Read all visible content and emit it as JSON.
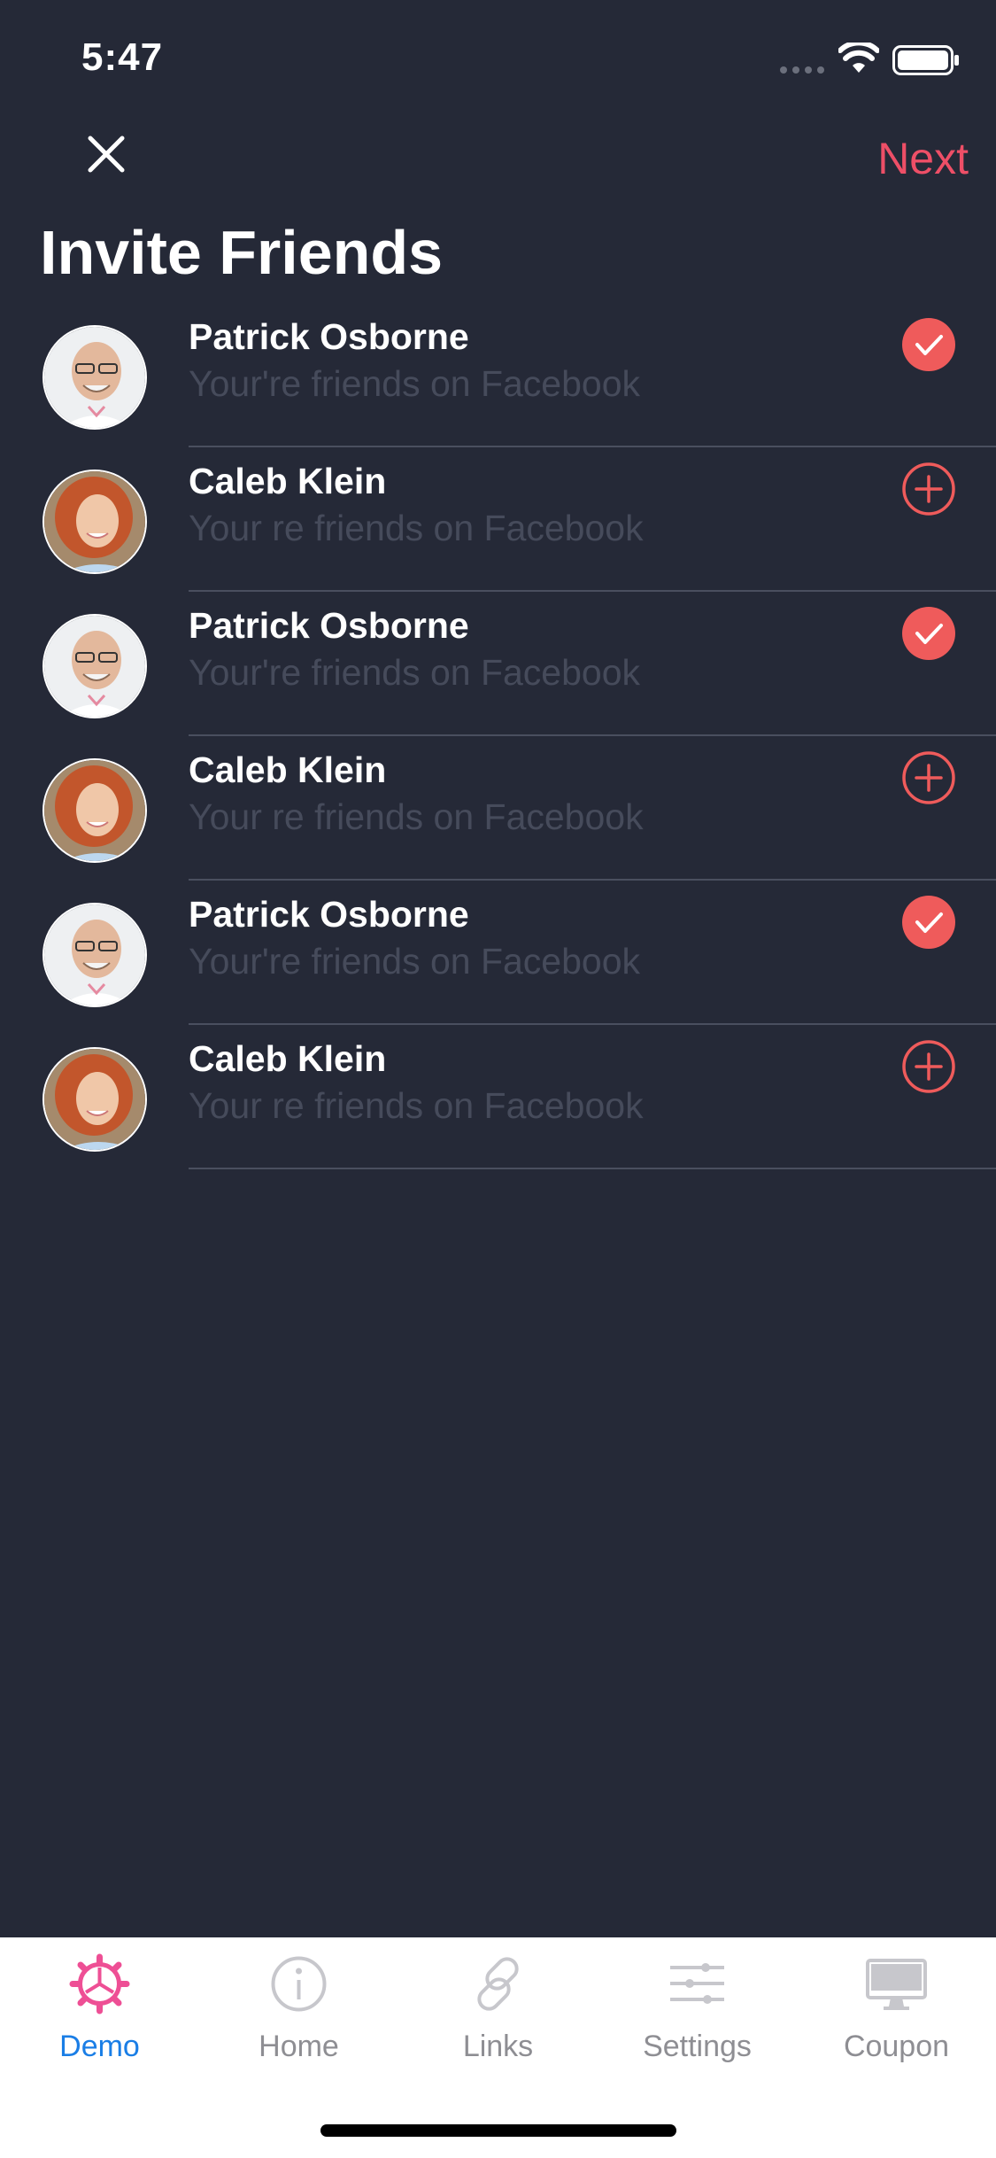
{
  "status_bar": {
    "time": "5:47"
  },
  "header": {
    "title": "Invite Friends",
    "next_label": "Next"
  },
  "colors": {
    "background": "#252937",
    "accent": "#ee4f67",
    "tab_active": "#1a7ee6",
    "tab_inactive": "#8e8e93",
    "subtext": "#464b5b"
  },
  "friends": [
    {
      "name": "Patrick Osborne",
      "subtitle": "Your're friends on Facebook",
      "avatar": "man",
      "selected": true
    },
    {
      "name": "Caleb Klein",
      "subtitle": "Your re friends on Facebook",
      "avatar": "woman",
      "selected": false
    },
    {
      "name": "Patrick Osborne",
      "subtitle": "Your're friends on Facebook",
      "avatar": "man",
      "selected": true
    },
    {
      "name": "Caleb Klein",
      "subtitle": "Your re friends on Facebook",
      "avatar": "woman",
      "selected": false
    },
    {
      "name": "Patrick Osborne",
      "subtitle": "Your're friends on Facebook",
      "avatar": "man",
      "selected": true
    },
    {
      "name": "Caleb Klein",
      "subtitle": "Your re friends on Facebook",
      "avatar": "woman",
      "selected": false
    }
  ],
  "tabs": [
    {
      "label": "Demo",
      "icon": "gear-icon",
      "active": true
    },
    {
      "label": "Home",
      "icon": "info-icon",
      "active": false
    },
    {
      "label": "Links",
      "icon": "link-icon",
      "active": false
    },
    {
      "label": "Settings",
      "icon": "sliders-icon",
      "active": false
    },
    {
      "label": "Coupon",
      "icon": "monitor-icon",
      "active": false
    }
  ]
}
